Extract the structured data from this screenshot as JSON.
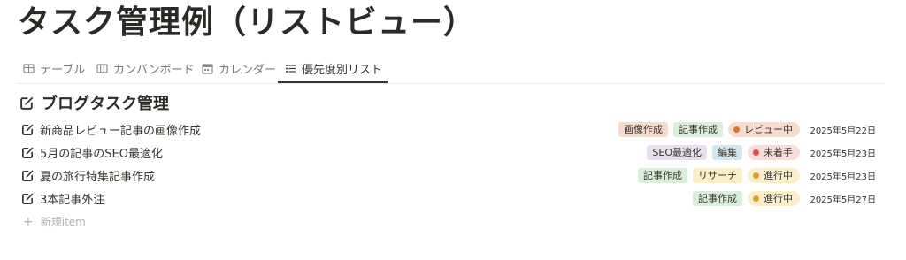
{
  "page": {
    "title": "タスク管理例（リストビュー）"
  },
  "tabs": [
    {
      "label": "テーブル",
      "icon": "table-icon",
      "active": false
    },
    {
      "label": "カンバンボード",
      "icon": "board-icon",
      "active": false
    },
    {
      "label": "カレンダー",
      "icon": "calendar-icon",
      "active": false
    },
    {
      "label": "優先度別リスト",
      "icon": "list-icon",
      "active": true
    }
  ],
  "group": {
    "title": "ブログタスク管理",
    "icon": "edit-icon"
  },
  "tasks": [
    {
      "title": "新商品レビュー記事の画像作成",
      "tags": [
        {
          "label": "画像作成",
          "bg": "#f7dccd"
        },
        {
          "label": "記事作成",
          "bg": "#dbeddb"
        }
      ],
      "status": {
        "label": "レビュー中",
        "bg": "#f8dccd",
        "dot": "#e0762c"
      },
      "date": "2025年5月22日"
    },
    {
      "title": "5月の記事のSEO最適化",
      "tags": [
        {
          "label": "SEO最適化",
          "bg": "#e8deee"
        },
        {
          "label": "編集",
          "bg": "#d3e5ef"
        }
      ],
      "status": {
        "label": "未着手",
        "bg": "#fadcdc",
        "dot": "#e0504a"
      },
      "date": "2025年5月23日"
    },
    {
      "title": "夏の旅行特集記事作成",
      "tags": [
        {
          "label": "記事作成",
          "bg": "#dbeddb"
        },
        {
          "label": "リサーチ",
          "bg": "#fbeecb"
        }
      ],
      "status": {
        "label": "進行中",
        "bg": "#fbeecb",
        "dot": "#dba12d"
      },
      "date": "2025年5月23日"
    },
    {
      "title": "3本記事外注",
      "tags": [
        {
          "label": "記事作成",
          "bg": "#dbeddb"
        }
      ],
      "status": {
        "label": "進行中",
        "bg": "#fbeecb",
        "dot": "#dba12d"
      },
      "date": "2025年5月27日"
    }
  ],
  "new_item": {
    "label": "新規item"
  }
}
